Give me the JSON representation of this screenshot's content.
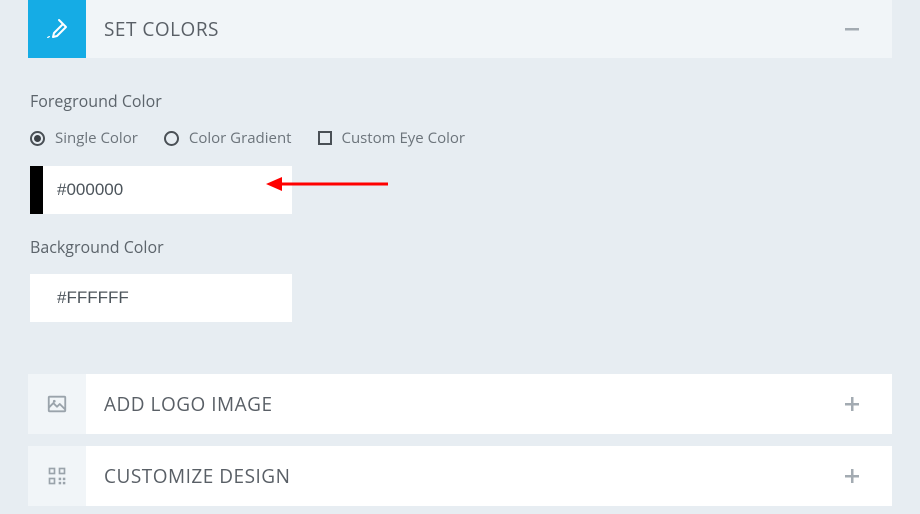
{
  "panels": {
    "set_colors": {
      "title": "SET COLORS"
    },
    "add_logo": {
      "title": "ADD LOGO IMAGE"
    },
    "customize": {
      "title": "CUSTOMIZE DESIGN"
    }
  },
  "foreground": {
    "label": "Foreground Color",
    "options": {
      "single": "Single Color",
      "gradient": "Color Gradient",
      "eye": "Custom Eye Color"
    },
    "value": "#000000",
    "swatch": "#000000"
  },
  "background": {
    "label": "Background Color",
    "value": "#FFFFFF",
    "swatch": "#FFFFFF"
  },
  "icons": {
    "brush": "brush-icon",
    "image": "image-icon",
    "qr": "qr-icon",
    "minus": "−",
    "plus": "+"
  }
}
